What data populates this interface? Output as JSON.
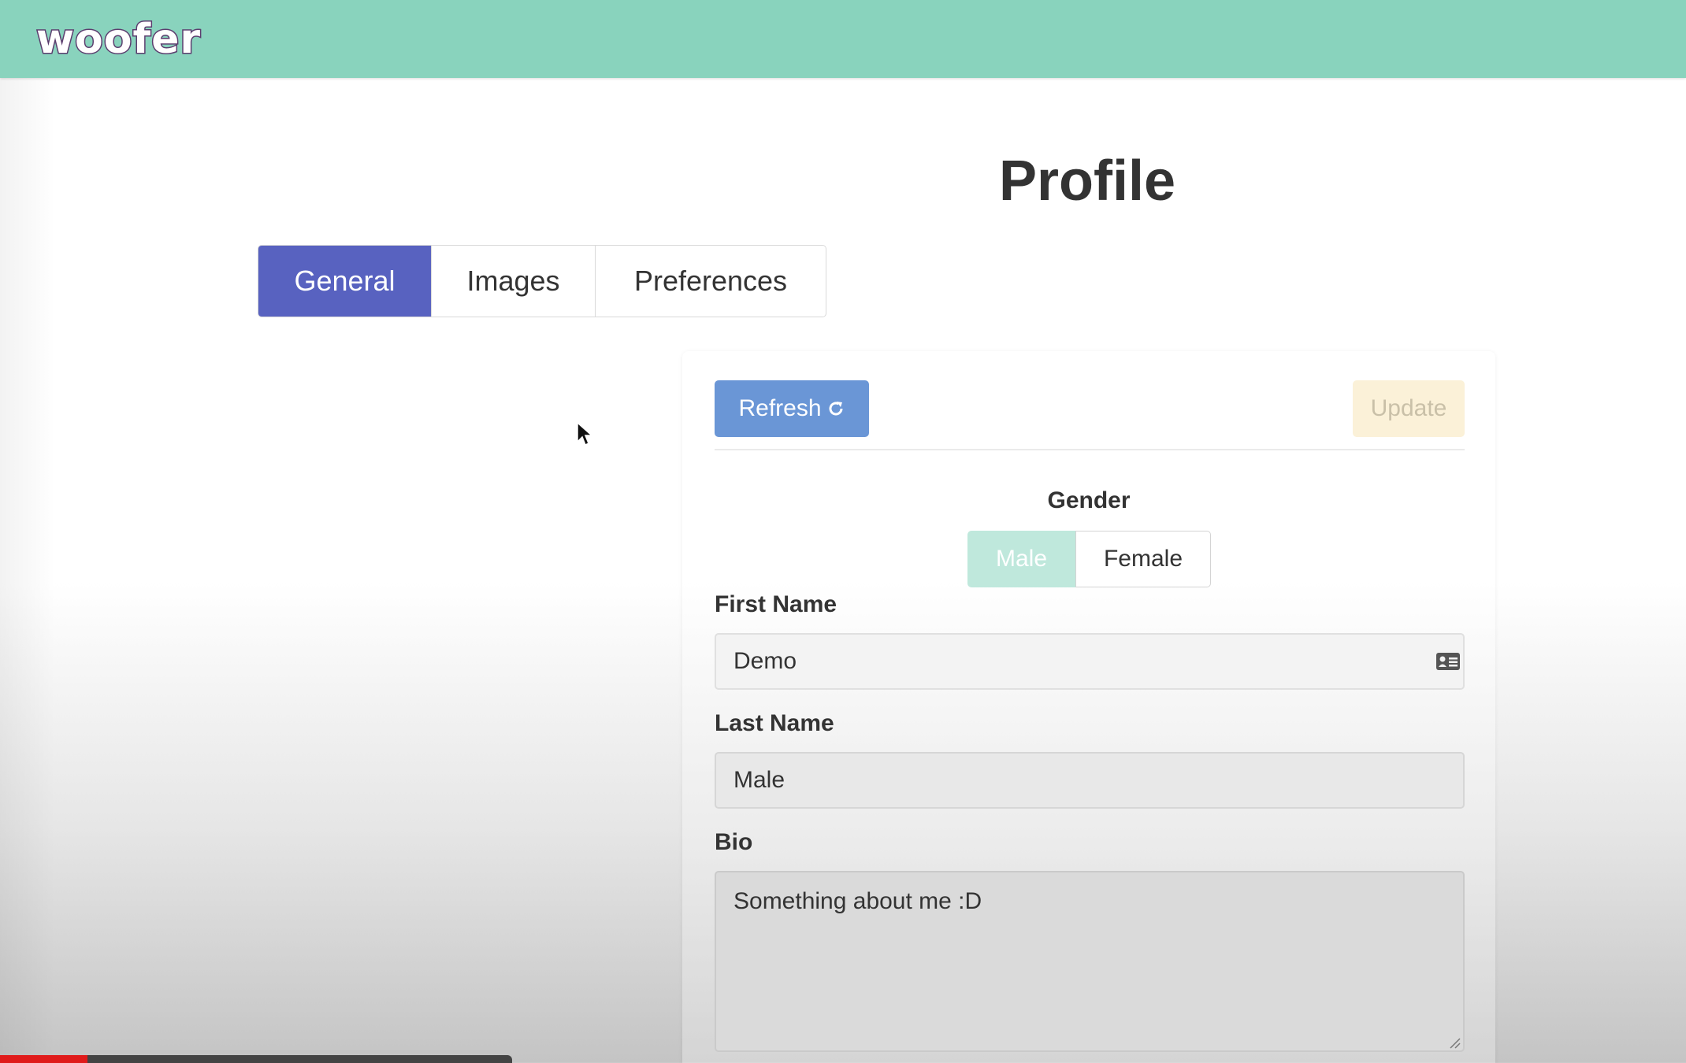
{
  "app": {
    "logo_text": "woofer"
  },
  "page": {
    "title": "Profile"
  },
  "tabs": [
    {
      "label": "General",
      "active": true
    },
    {
      "label": "Images",
      "active": false
    },
    {
      "label": "Preferences",
      "active": false
    }
  ],
  "toolbar": {
    "refresh_label": "Refresh",
    "refresh_icon": "refresh-icon",
    "update_label": "Update"
  },
  "form": {
    "gender_label": "Gender",
    "gender_options": [
      {
        "label": "Male",
        "selected": true
      },
      {
        "label": "Female",
        "selected": false
      }
    ],
    "first_name_label": "First Name",
    "first_name_value": "Demo",
    "last_name_label": "Last Name",
    "last_name_value": "Male",
    "bio_label": "Bio",
    "bio_value": "Something about me :D"
  },
  "video": {
    "progress": 0.17
  },
  "colors": {
    "header": "#89d3bd",
    "active_tab": "#5862c0",
    "refresh_button": "#6a96d6",
    "update_button": "#fbf1d8",
    "male_selected": "#bfe8dc"
  }
}
